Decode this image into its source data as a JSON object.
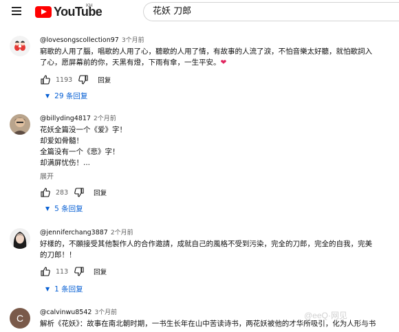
{
  "header": {
    "brand": "YouTube",
    "region": "KH",
    "search_value": "花妖 刀郎"
  },
  "comments": [
    {
      "author": "@lovesongscollection97",
      "time": "3个月前",
      "lines": [
        "窮歌的人用了腦，唱歌的人用了心，聽歌的人用了情，有故事的人流了淚，不怕音樂太好聽，就怕歌詞入",
        "了心，愿屏幕前的你，天黑有燈，下雨有傘，一生平安。"
      ],
      "heart": "❤",
      "likes": "1193",
      "reply_label": "回复",
      "replies_label": "29 条回复"
    },
    {
      "author": "@billyding4817",
      "time": "2个月前",
      "lines": [
        "花妖全篇没一个《爱》字！",
        "却爱如骨髓！",
        "全篇没有一个《悲》字！",
        "却满屏忧伤！..."
      ],
      "expand": "展开",
      "likes": "283",
      "reply_label": "回复",
      "replies_label": "5 条回复"
    },
    {
      "author": "@jenniferchang3887",
      "time": "2个月前",
      "lines": [
        "好樣的，不願接受其他製作人的合作邀請，成就自己的風格不受到污染，完全的刀郎，完全的自我，完美",
        "的刀郎！！"
      ],
      "likes": "113",
      "reply_label": "回复",
      "replies_label": "1 条回复"
    },
    {
      "author": "@calvinwu8542",
      "time": "3个月前",
      "avatar_letter": "C",
      "lines": [
        "解析《花妖》：故事在南北朝时期，一书生长年在山中苦读诗书，两花妖被他的才华所吸引，化为人形与书"
      ]
    }
  ],
  "watermark": "@eeQ·网见",
  "colors": {
    "brand_red": "#ff0000",
    "link_blue": "#065fd4",
    "meta_gray": "#606060",
    "avatar_c": "#7a5a4a"
  },
  "icons": [
    "menu-icon",
    "youtube-play-icon",
    "thumb-up-icon",
    "thumb-down-icon",
    "caret-down-icon"
  ]
}
